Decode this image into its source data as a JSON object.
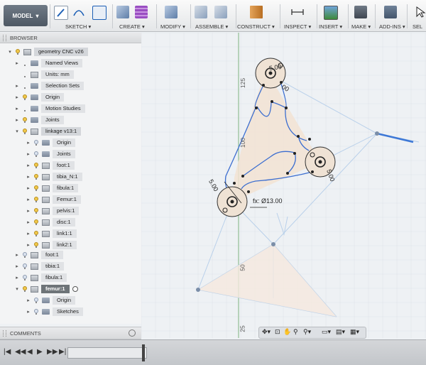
{
  "toolbar": {
    "mode_label": "MODEL",
    "groups": [
      "SKETCH",
      "CREATE",
      "MODIFY",
      "ASSEMBLE",
      "CONSTRUCT",
      "INSPECT",
      "INSERT",
      "MAKE",
      "ADD-INS",
      "SEL"
    ]
  },
  "browser": {
    "header": "BROWSER",
    "items": [
      {
        "label": "geometry CNC v26"
      },
      {
        "label": "Named Views"
      },
      {
        "label": "Units: mm"
      },
      {
        "label": "Selection Sets"
      },
      {
        "label": "Origin"
      },
      {
        "label": "Motion Studies"
      },
      {
        "label": "Joints"
      },
      {
        "label": "linkage v13:1"
      },
      {
        "label": "Origin"
      },
      {
        "label": "Joints"
      },
      {
        "label": "foot:1"
      },
      {
        "label": "tibia_N:1"
      },
      {
        "label": "fibula:1"
      },
      {
        "label": "Femur:1"
      },
      {
        "label": "pelvis:1"
      },
      {
        "label": "disc:1"
      },
      {
        "label": "link1:1"
      },
      {
        "label": "link2:1"
      },
      {
        "label": "foot:1"
      },
      {
        "label": "tibia:1"
      },
      {
        "label": "fibula:1"
      },
      {
        "label": "femur:1"
      },
      {
        "label": "Origin"
      },
      {
        "label": "Sketches"
      }
    ]
  },
  "comments": {
    "header": "COMMENTS"
  },
  "canvas": {
    "dims": [
      "5.00",
      "5.00",
      "5.00",
      "5.00"
    ],
    "dim_partial": "00",
    "dim_diameter": "fx: Ø13.00",
    "ruler_125": "125",
    "ruler_100": "100",
    "ruler_50": "50",
    "ruler_25": "25",
    "overlay_text": "5.00"
  },
  "colors": {
    "accent": "#2f6fd0",
    "sketch_fill": "#f2e3d2"
  }
}
